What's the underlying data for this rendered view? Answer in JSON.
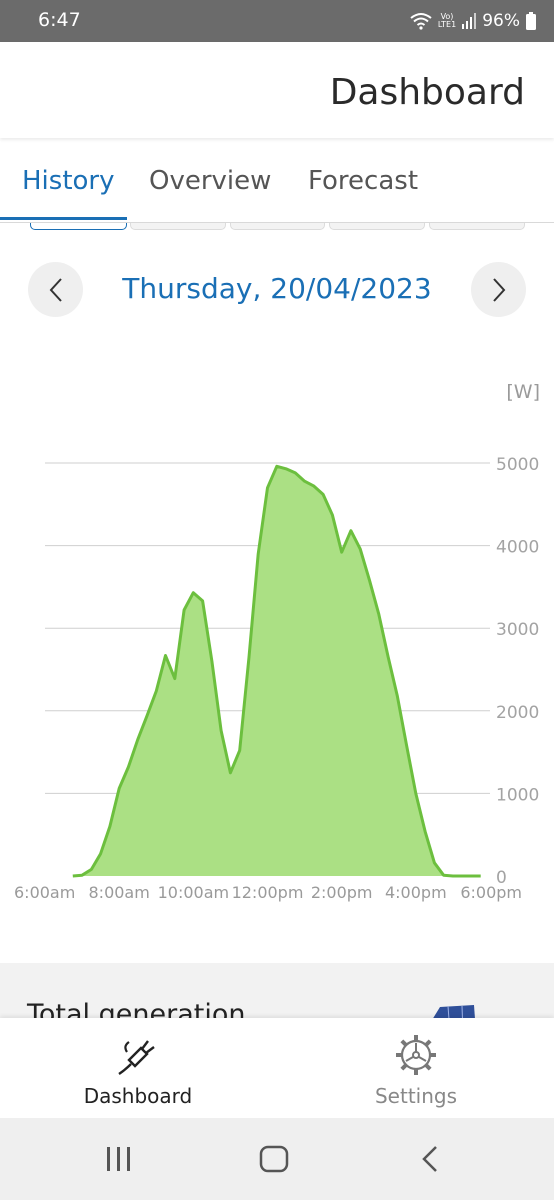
{
  "status_bar": {
    "time": "6:47",
    "network": "LTE1",
    "battery": "96%"
  },
  "header": {
    "title": "Dashboard"
  },
  "tabs": [
    {
      "label": "History"
    },
    {
      "label": "Overview"
    },
    {
      "label": "Forecast"
    }
  ],
  "date_nav": {
    "date": "Thursday, 20/04/2023",
    "prev_icon": "chevron-left-icon",
    "next_icon": "chevron-right-icon"
  },
  "chart_data": {
    "type": "area",
    "title": "",
    "xlabel": "",
    "ylabel": "[W]",
    "xlim": [
      "6:00am",
      "6:00pm"
    ],
    "ylim": [
      0,
      5000
    ],
    "x_tick_labels": [
      "6:00am",
      "8:00am",
      "10:00am",
      "12:00pm",
      "2:00pm",
      "4:00pm",
      "6:00pm"
    ],
    "y_tick_labels": [
      "0",
      "1000",
      "2000",
      "3000",
      "4000",
      "5000"
    ],
    "grid": true,
    "color": "#6cbf3e",
    "fill_color": "#abe084",
    "series": [
      {
        "x": [
          "6:45am",
          "7:00am",
          "7:15am",
          "7:30am",
          "7:45am",
          "8:00am",
          "8:15am",
          "8:30am",
          "8:45am",
          "9:00am",
          "9:15am",
          "9:30am",
          "9:45am",
          "10:00am",
          "10:15am",
          "10:30am",
          "10:45am",
          "11:00am",
          "11:15am",
          "11:30am",
          "11:45am",
          "12:00pm",
          "12:15pm",
          "12:30pm",
          "12:45pm",
          "1:00pm",
          "1:15pm",
          "1:30pm",
          "1:45pm",
          "2:00pm",
          "2:15pm",
          "2:30pm",
          "2:45pm",
          "3:00pm",
          "3:15pm",
          "3:30pm",
          "3:45pm",
          "4:00pm",
          "4:15pm",
          "4:30pm",
          "4:45pm",
          "5:00pm",
          "5:15pm",
          "5:30pm",
          "5:45pm"
        ],
        "values": [
          0,
          10,
          80,
          270,
          600,
          1060,
          1320,
          1650,
          1940,
          2240,
          2670,
          2390,
          3220,
          3430,
          3330,
          2600,
          1760,
          1250,
          1520,
          2650,
          3900,
          4700,
          4960,
          4930,
          4880,
          4780,
          4720,
          4620,
          4370,
          3920,
          4180,
          3960,
          3580,
          3170,
          2660,
          2180,
          1580,
          1000,
          540,
          160,
          10,
          0,
          0,
          0,
          0
        ]
      }
    ]
  },
  "summary": {
    "title": "Total generation"
  },
  "bottom_nav": [
    {
      "label": "Dashboard",
      "icon": "plug-icon"
    },
    {
      "label": "Settings",
      "icon": "settings-gear-icon"
    }
  ],
  "system_nav": {
    "recents_icon": "recents-icon",
    "home_icon": "home-icon",
    "back_icon": "back-icon"
  }
}
